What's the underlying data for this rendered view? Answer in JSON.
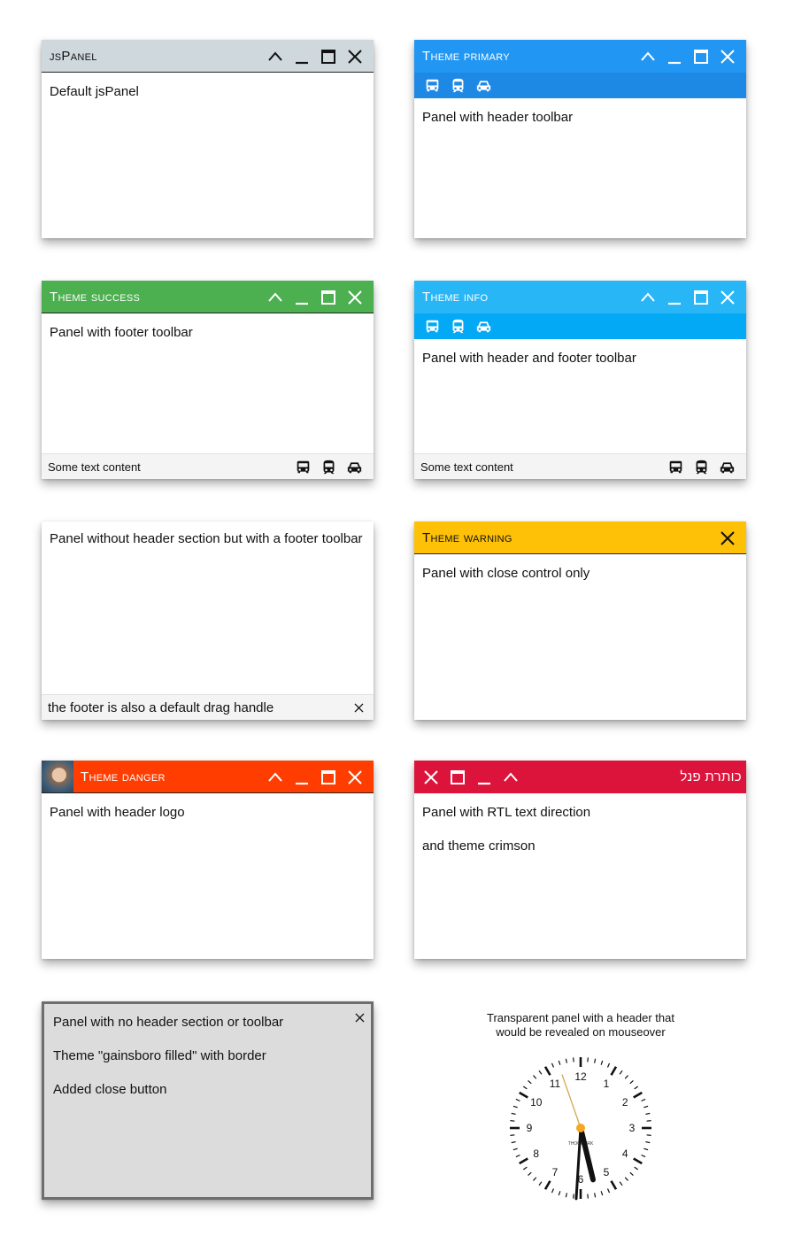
{
  "colors": {
    "default_header": "#cfd8dc",
    "primary": "#2196f3",
    "primary_toolbar": "#1e88e5",
    "success": "#4caf50",
    "info": "#29b6f6",
    "info_toolbar": "#03a9f4",
    "warning": "#ffc107",
    "danger": "#ff3d00",
    "crimson": "#dc143c",
    "gainsboro": "#dcdcdc",
    "clock_second_hand": "#f5a623"
  },
  "icons": {
    "controls": [
      "chevron-up-icon",
      "minimize-icon",
      "maximize-icon",
      "close-icon"
    ],
    "toolbar": [
      "bus-icon",
      "train-icon",
      "car-icon"
    ]
  },
  "panels": {
    "p1": {
      "title": "jsPanel",
      "content": "Default jsPanel"
    },
    "p2": {
      "title": "Theme primary",
      "content": "Panel with header toolbar"
    },
    "p3": {
      "title": "Theme success",
      "content": "Panel with footer toolbar",
      "footer_text": "Some text content"
    },
    "p4": {
      "title": "Theme info",
      "content": "Panel with header and footer toolbar",
      "footer_text": "Some text content"
    },
    "p5": {
      "content": "Panel without header section but with a footer toolbar",
      "footer_text": "the footer is also a default drag handle"
    },
    "p6": {
      "title": "Theme warning",
      "content": "Panel with close control only"
    },
    "p7": {
      "title": "Theme danger",
      "content": "Panel with header logo"
    },
    "p8": {
      "title": "כותרת פנל",
      "content_1": "Panel with RTL text direction",
      "content_2": "and theme crimson"
    },
    "p9": {
      "content_1": "Panel with no header section or toolbar",
      "content_2": "Theme \"gainsboro filled\" with border",
      "content_3": "Added close button"
    }
  },
  "clock": {
    "caption_line1": "Transparent panel with a header that",
    "caption_line2": "would be revealed on mouseover",
    "numbers": [
      "12",
      "1",
      "2",
      "3",
      "4",
      "5",
      "6",
      "7",
      "8",
      "9",
      "10",
      "11"
    ],
    "brand": "THOOGERK",
    "time": {
      "hour": 5.55,
      "minute": 30.6,
      "second": 56.8
    }
  }
}
